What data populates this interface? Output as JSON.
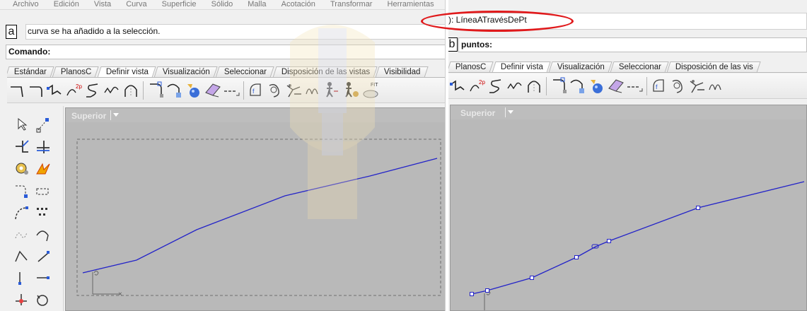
{
  "pane_a": {
    "panel_letter": "a",
    "menu_items": [
      "Archivo",
      "Edición",
      "Vista",
      "Curva",
      "Superficie",
      "Sólido",
      "Malla",
      "Acotación",
      "Transformar",
      "Herramientas"
    ],
    "history_text": "curva se ha añadido a la selección.",
    "command_label": "Comando:",
    "tabs": [
      "Estándar",
      "PlanosC",
      "Definir vista",
      "Visualización",
      "Seleccionar",
      "Disposición de las vistas",
      "Visibilidad"
    ],
    "viewport_label": "Superior"
  },
  "pane_b": {
    "panel_letter": "b",
    "history_text": "): LíneaATravésDePt",
    "command_label": "puntos:",
    "tabs": [
      "PlanosC",
      "Definir vista",
      "Visualización",
      "Seleccionar",
      "Disposición de las vis"
    ],
    "viewport_label": "Superior"
  },
  "colors": {
    "curve": "#2323c8",
    "viewport_bg": "#b9b9b9",
    "highlight_ellipse": "#e0191b"
  },
  "icons": {
    "toolbar_a": [
      "curve-corner-icon",
      "curve-corner-2-icon",
      "polyline-icon",
      "degree-curve-icon",
      "spline-icon",
      "freeform-curve-icon",
      "arc-icon",
      "fillet-curve-icon",
      "curve-from-object-icon",
      "sphere-render-icon",
      "paint-icon",
      "dimension-icon",
      "rebuild-icon",
      "sweep-icon",
      "loft-icon",
      "offset-icon",
      "walk-icon",
      "walk-2-icon",
      "zoom-fit-icon"
    ],
    "toolbar_b": [
      "polyline-icon",
      "degree-curve-icon",
      "spline-icon",
      "freeform-curve-icon",
      "arc-icon",
      "fillet-curve-icon",
      "curve-from-object-icon",
      "sphere-render-icon",
      "paint-icon",
      "dimension-icon",
      "rebuild-icon",
      "sweep-icon",
      "loft-icon",
      "offset-icon"
    ],
    "left_tools": [
      "select-arrow-icon",
      "point-curve-icon",
      "trim-icon",
      "extend-icon",
      "gear-analyze-icon",
      "explode-icon",
      "curve-edit-icon",
      "curve-points-icon",
      "curve-bend-icon",
      "control-points-icon",
      "curve-smooth-icon",
      "curve-arc-icon",
      "polyline-draw-icon",
      "line-segment-icon",
      "line-endpoints-icon",
      "line-draw-icon",
      "gumball-icon",
      "rotate-icon"
    ]
  }
}
